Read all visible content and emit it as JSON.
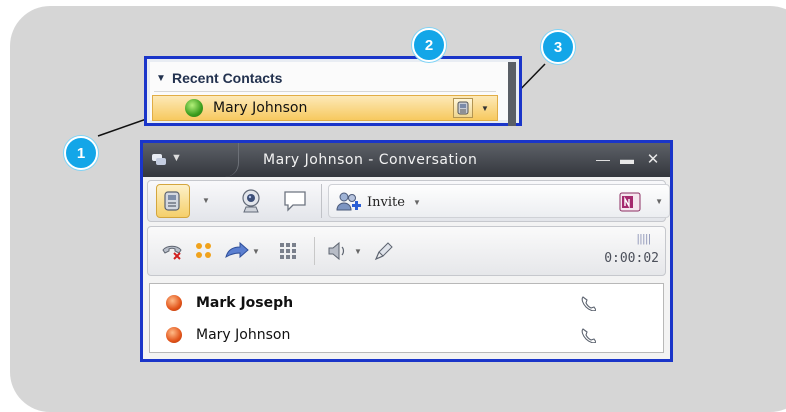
{
  "recent_contacts": {
    "header": "Recent Contacts",
    "contact_name": "Mary Johnson"
  },
  "callouts": [
    "1",
    "2",
    "3"
  ],
  "conversation": {
    "title": "Mary Johnson - Conversation",
    "invite_label": "Invite",
    "timer": "0:00:02",
    "participants": [
      {
        "name": "Mark Joseph",
        "bold": true
      },
      {
        "name": "Mary Johnson",
        "bold": false
      }
    ]
  },
  "colors": {
    "highlight_border": "#1a35c9",
    "callout": "#13a6e8",
    "presence_available": "#3c9e1f",
    "presence_busy": "#e2541a"
  },
  "icons": {
    "chevron": "chevron-down-icon",
    "call": "phone-icon",
    "video": "webcam-icon",
    "im": "speech-bubble-icon",
    "invite": "people-add-icon",
    "onenote": "onenote-icon",
    "hangup": "hang-up-icon",
    "hold": "hold-icon",
    "transfer": "transfer-icon",
    "dialpad": "dialpad-icon",
    "volume": "speaker-icon",
    "mic": "microphone-icon"
  }
}
